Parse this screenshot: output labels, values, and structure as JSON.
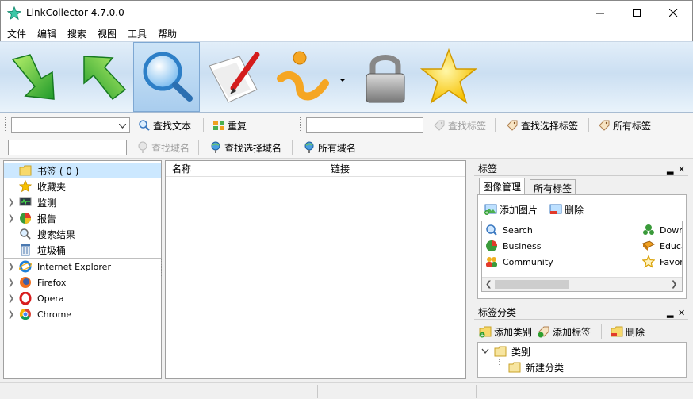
{
  "window": {
    "title": "LinkCollector 4.7.0.0"
  },
  "menu": [
    "文件",
    "编辑",
    "搜索",
    "视图",
    "工具",
    "帮助"
  ],
  "big_toolbar": {
    "icons": [
      "green-down-arrow-icon",
      "green-up-arrow-icon",
      "magnifier-icon",
      "paper-pen-icon",
      "info-icon",
      "padlock-icon",
      "star-icon"
    ],
    "colors": {
      "accent": "#3cb043",
      "gold": "#f6c000"
    }
  },
  "search_toolbar": {
    "find_text": "查找文本",
    "repeat": "重复",
    "find_tag": "查找标签",
    "find_selected_tag": "查找选择标签",
    "all_tags": "所有标签",
    "find_domain": "查找域名",
    "find_selected_domain": "查找选择域名",
    "all_domains": "所有域名"
  },
  "left_tree": {
    "items": [
      {
        "label": "书签 ( 0 )",
        "icon": "folder-icon",
        "selected": true,
        "expandable": false
      },
      {
        "label": "收藏夹",
        "icon": "star-icon",
        "selected": false,
        "expandable": false
      },
      {
        "label": "监测",
        "icon": "monitor-icon",
        "selected": false,
        "expandable": true
      },
      {
        "label": "报告",
        "icon": "pie-chart-icon",
        "selected": false,
        "expandable": true
      },
      {
        "label": "搜索结果",
        "icon": "magnifier-icon",
        "selected": false,
        "expandable": false
      },
      {
        "label": "垃圾桶",
        "icon": "trash-icon",
        "selected": false,
        "expandable": false
      }
    ],
    "browsers": [
      {
        "label": "Internet Explorer",
        "icon": "ie-icon"
      },
      {
        "label": "Firefox",
        "icon": "firefox-icon"
      },
      {
        "label": "Opera",
        "icon": "opera-icon"
      },
      {
        "label": "Chrome",
        "icon": "chrome-icon"
      }
    ]
  },
  "list": {
    "columns": [
      "名称",
      "链接"
    ]
  },
  "tags_panel": {
    "title": "标签",
    "tabs": [
      "图像管理",
      "所有标签"
    ],
    "add_image": "添加图片",
    "delete": "删除",
    "images": [
      {
        "label": "Search",
        "icon": "magnifier-icon"
      },
      {
        "label": "Business",
        "icon": "pie-chart-icon"
      },
      {
        "label": "Community",
        "icon": "people-icon"
      },
      {
        "label": "Down",
        "icon": "tree-icon"
      },
      {
        "label": "Educa",
        "icon": "book-icon"
      },
      {
        "label": "Favor",
        "icon": "star-outline-icon"
      }
    ]
  },
  "category_panel": {
    "title": "标签分类",
    "add_category": "添加类别",
    "add_tag": "添加标签",
    "delete": "删除",
    "tree": {
      "root": "类别",
      "child": "新建分类"
    }
  }
}
